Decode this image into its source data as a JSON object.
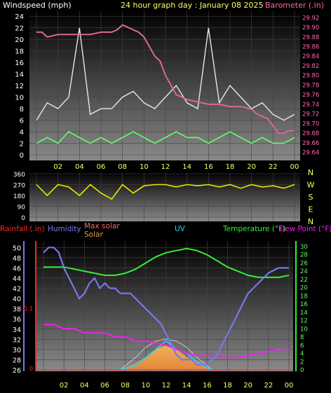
{
  "chart_data": [
    {
      "type": "line",
      "title": "24 hour graph day : January 08 2025",
      "left_axis_label": "Windspeed (mph)",
      "right_axis_label": "Barometer (.in)",
      "y_left_ticks": [
        0,
        2,
        4,
        6,
        8,
        10,
        12,
        14,
        16,
        18,
        20,
        22,
        24
      ],
      "y_left_range": [
        0,
        25
      ],
      "y_right_ticks": [
        29.64,
        29.66,
        29.68,
        29.7,
        29.72,
        29.74,
        29.76,
        29.78,
        29.8,
        29.82,
        29.84,
        29.86,
        29.88,
        29.9,
        29.92
      ],
      "y_right_range": [
        29.635,
        29.935
      ],
      "x_ticks": [
        "02",
        "04",
        "06",
        "08",
        "10",
        "12",
        "14",
        "16",
        "18",
        "20",
        "22",
        "00"
      ],
      "grid": true,
      "colors": {
        "gust": "#e8e8e8",
        "wind": "#66ff66",
        "barometer": "#dd6699",
        "title": "#ffff66",
        "left_label": "#ffffff",
        "right_label": "#ff66aa"
      },
      "series": [
        {
          "key": "barometer",
          "x": [
            0.0,
            0.5,
            1.0,
            2.0,
            3.0,
            4.0,
            5.0,
            6.0,
            7.0,
            7.5,
            8.0,
            8.5,
            9.0,
            9.5,
            10.0,
            10.5,
            11.0,
            11.5,
            12.0,
            12.5,
            13.0,
            14.0,
            15.0,
            16.0,
            16.5,
            17.0,
            18.0,
            19.0,
            20.0,
            20.5,
            21.0,
            21.5,
            22.0,
            22.5,
            23.0,
            23.5,
            24.0
          ],
          "y": [
            29.89,
            29.89,
            29.88,
            29.885,
            29.885,
            29.885,
            29.885,
            29.89,
            29.89,
            29.895,
            29.905,
            29.9,
            29.895,
            29.89,
            29.88,
            29.86,
            29.84,
            29.83,
            29.8,
            29.78,
            29.76,
            29.75,
            29.745,
            29.74,
            29.74,
            29.74,
            29.735,
            29.735,
            29.73,
            29.72,
            29.715,
            29.71,
            29.695,
            29.68,
            29.68,
            29.685,
            29.685
          ]
        },
        {
          "key": "wind",
          "x": [
            0,
            1,
            2,
            3,
            4,
            5,
            6,
            7,
            8,
            9,
            10,
            11,
            12,
            13,
            14,
            15,
            16,
            17,
            18,
            19,
            20,
            21,
            22,
            23,
            24
          ],
          "y": [
            2,
            3,
            2,
            4,
            3,
            2,
            3,
            2,
            3,
            4,
            3,
            2,
            3,
            4,
            3,
            3,
            2,
            3,
            4,
            3,
            2,
            3,
            2,
            2,
            3
          ]
        },
        {
          "key": "gust",
          "x": [
            0,
            1,
            2,
            3,
            4,
            5,
            6,
            7,
            8,
            9,
            10,
            11,
            12,
            13,
            14,
            15,
            16,
            17,
            18,
            19,
            20,
            21,
            22,
            23,
            24
          ],
          "y": [
            6,
            9,
            8,
            10,
            22,
            7,
            8,
            8,
            10,
            11,
            9,
            8,
            10,
            12,
            9,
            8,
            22,
            9,
            12,
            10,
            8,
            9,
            7,
            6,
            7
          ]
        }
      ]
    },
    {
      "type": "line",
      "right_labels": [
        "N",
        "W",
        "S",
        "E",
        "N"
      ],
      "y_ticks": [
        0,
        90,
        180,
        270,
        360
      ],
      "y_range": [
        0,
        360
      ],
      "colors": {
        "direction": "#e8e800"
      },
      "series": [
        {
          "key": "direction",
          "x": [
            0,
            1,
            2,
            3,
            4,
            5,
            6,
            7,
            8,
            9,
            10,
            11,
            12,
            13,
            14,
            15,
            16,
            17,
            18,
            19,
            20,
            21,
            22,
            23,
            24
          ],
          "y": [
            270,
            180,
            270,
            250,
            180,
            270,
            200,
            150,
            270,
            200,
            260,
            270,
            270,
            250,
            270,
            260,
            270,
            250,
            270,
            240,
            270,
            250,
            260,
            240,
            270
          ]
        }
      ]
    },
    {
      "type": "line",
      "legend": [
        "Rainfall (.in)",
        "Humidity",
        "Max solar",
        "Solar",
        "UV",
        "Temperature (°F)",
        "Dew Point (°F)"
      ],
      "y_left_ticks": [
        26,
        28,
        30,
        32,
        34,
        36,
        38,
        40,
        42,
        44,
        46,
        48,
        50
      ],
      "y_left_range": [
        26,
        51
      ],
      "y_rain_ticks": [
        "0",
        "0.1"
      ],
      "y_right_ticks": [
        0,
        2,
        4,
        6,
        8,
        10,
        12,
        14,
        16,
        18,
        20,
        22,
        24,
        26,
        28,
        30
      ],
      "y_right_range": [
        0,
        31
      ],
      "x_ticks": [
        "02",
        "04",
        "06",
        "08",
        "10",
        "12",
        "14",
        "16",
        "18",
        "20",
        "22",
        "00"
      ],
      "colors": {
        "rain": "#ff2222",
        "humidity": "#7777ee",
        "max_solar": "#ff6666",
        "solar": "#d4a24c",
        "uv": "#33ccee",
        "temperature": "#33ee33",
        "dew": "#ee22ee"
      },
      "series": [
        {
          "key": "humidity",
          "x": [
            0,
            0.5,
            1,
            1.5,
            2,
            2.5,
            3,
            3.5,
            4,
            4.5,
            5,
            5.5,
            6,
            6.5,
            7,
            7.5,
            8,
            8.5,
            9,
            9.5,
            10,
            10.5,
            11,
            11.5,
            12,
            12.5,
            13,
            13.5,
            14,
            14.5,
            15,
            15.5,
            16,
            16.5,
            17,
            17.5,
            18,
            18.5,
            19,
            19.5,
            20,
            20.5,
            21,
            21.5,
            22,
            22.5,
            23,
            23.5,
            24
          ],
          "y": [
            49,
            50,
            50,
            49,
            46,
            44,
            42,
            40,
            41,
            43,
            44,
            42,
            43,
            42,
            42,
            41,
            41,
            41,
            40,
            39,
            38,
            37,
            36,
            35,
            33,
            31,
            29,
            28,
            28,
            28,
            27,
            27,
            27,
            28,
            29,
            31,
            33,
            35,
            37,
            39,
            41,
            42,
            43,
            44,
            45,
            45.5,
            46,
            46,
            46
          ]
        },
        {
          "key": "temperature",
          "x": [
            0,
            1,
            2,
            3,
            4,
            5,
            6,
            7,
            8,
            9,
            10,
            11,
            12,
            13,
            14,
            15,
            16,
            17,
            18,
            19,
            20,
            21,
            22,
            23,
            24
          ],
          "y": [
            25,
            25,
            25,
            24.5,
            24,
            23.5,
            23,
            23,
            23.5,
            24.5,
            26,
            27.5,
            28.5,
            29,
            29.5,
            29,
            28,
            26.5,
            25,
            24,
            23,
            22.5,
            22.5,
            22.5,
            23
          ]
        },
        {
          "key": "dew",
          "x": [
            0,
            1,
            2,
            3,
            4,
            5,
            6,
            7,
            8,
            9,
            10,
            11,
            12,
            13,
            14,
            15,
            16,
            17,
            18,
            19,
            20,
            21,
            22,
            23,
            24
          ],
          "y": [
            11,
            11,
            10,
            10,
            9,
            9,
            9,
            8,
            8,
            7,
            7,
            6.5,
            6,
            5,
            4,
            3.5,
            3.5,
            3.5,
            3,
            3,
            3.5,
            4,
            4.5,
            5,
            5
          ]
        },
        {
          "key": "max_solar",
          "x": [
            7.5,
            8,
            9,
            10,
            11,
            12,
            13,
            14,
            15,
            16,
            16.5
          ],
          "y": [
            0,
            1,
            3,
            5.5,
            7,
            7.5,
            7,
            5.5,
            3,
            1,
            0
          ]
        },
        {
          "key": "solar",
          "x": [
            7.5,
            8,
            9,
            10,
            11,
            12,
            13,
            14,
            15,
            16,
            16.5
          ],
          "y": [
            0,
            0.5,
            1.5,
            3,
            5,
            6,
            5,
            3,
            2,
            0.5,
            0
          ]
        },
        {
          "key": "uv",
          "x": [
            7.5,
            9,
            10,
            11,
            12,
            13,
            14,
            15,
            16,
            16.5
          ],
          "y": [
            0,
            1,
            3,
            5,
            7,
            5,
            4,
            2,
            0.5,
            0
          ]
        },
        {
          "key": "rain",
          "x": [
            0,
            24
          ],
          "y": [
            0,
            0
          ]
        }
      ]
    }
  ]
}
